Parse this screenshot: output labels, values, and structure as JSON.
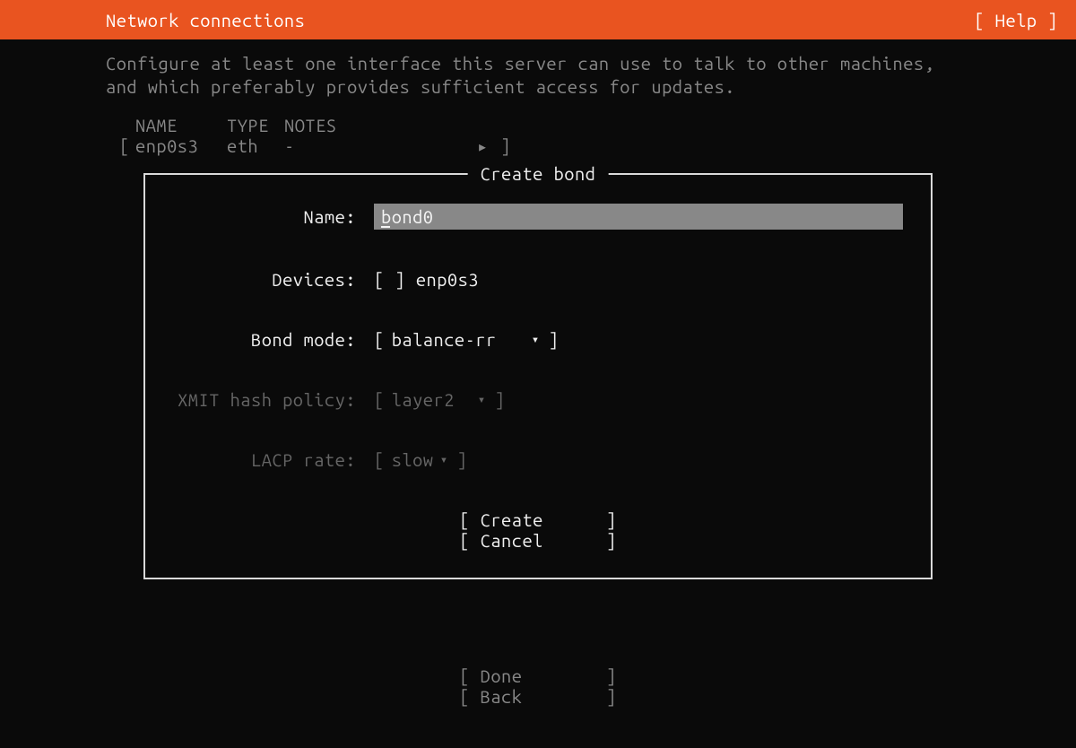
{
  "header": {
    "title": "Network connections",
    "help_label": "[ Help ]"
  },
  "description": "Configure at least one interface this server can use to talk to other machines, and which preferably provides sufficient access for updates.",
  "interface_table": {
    "headers": {
      "name": "NAME",
      "type": "TYPE",
      "notes": "NOTES"
    },
    "row": {
      "bracket_l": "[",
      "name": "enp0s3",
      "type": "eth",
      "notes": "-",
      "arrow": "▸",
      "bracket_r": "]"
    }
  },
  "dialog": {
    "title": "Create bond",
    "fields": {
      "name": {
        "label": "Name:",
        "value": "bond0"
      },
      "devices": {
        "label": "Devices:",
        "checkbox_state": "[ ]",
        "device_name": "enp0s3"
      },
      "bond_mode": {
        "label": "Bond mode:",
        "bracket_l": "[",
        "value": "balance-rr",
        "arrow": "▾",
        "bracket_r": "]"
      },
      "xmit_hash": {
        "label": "XMIT hash policy:",
        "bracket_l": "[",
        "value": "layer2",
        "arrow": "▾",
        "bracket_r": "]"
      },
      "lacp_rate": {
        "label": "LACP rate:",
        "bracket_l": "[",
        "value": "slow",
        "arrow": "▾",
        "bracket_r": "]"
      }
    },
    "buttons": {
      "create": "[ Create      ]",
      "cancel": "[ Cancel      ]"
    }
  },
  "footer": {
    "done": "[ Done        ]",
    "back": "[ Back        ]"
  }
}
